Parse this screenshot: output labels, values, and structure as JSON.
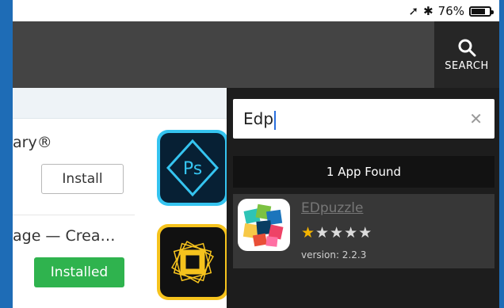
{
  "status": {
    "battery": "76%",
    "battery_level": 0.76
  },
  "header": {
    "search_label": "SEARCH"
  },
  "background_apps": [
    {
      "name_fragment": "ary®",
      "button": "Install",
      "icon": "photoshop-express-icon"
    },
    {
      "name_fragment": "age — Crea…",
      "button": "Installed",
      "icon": "adobe-spark-icon"
    }
  ],
  "search_panel": {
    "query": "Edp",
    "found_text": "1 App Found",
    "result": {
      "name": "EDpuzzle",
      "rating": 1,
      "rating_max": 5,
      "version": "version: 2.2.3",
      "icon": "edpuzzle-icon"
    }
  },
  "colors": {
    "accent_blue": "#1e6cb6",
    "installed_green": "#2fb34e",
    "star_gold": "#f4b400"
  }
}
